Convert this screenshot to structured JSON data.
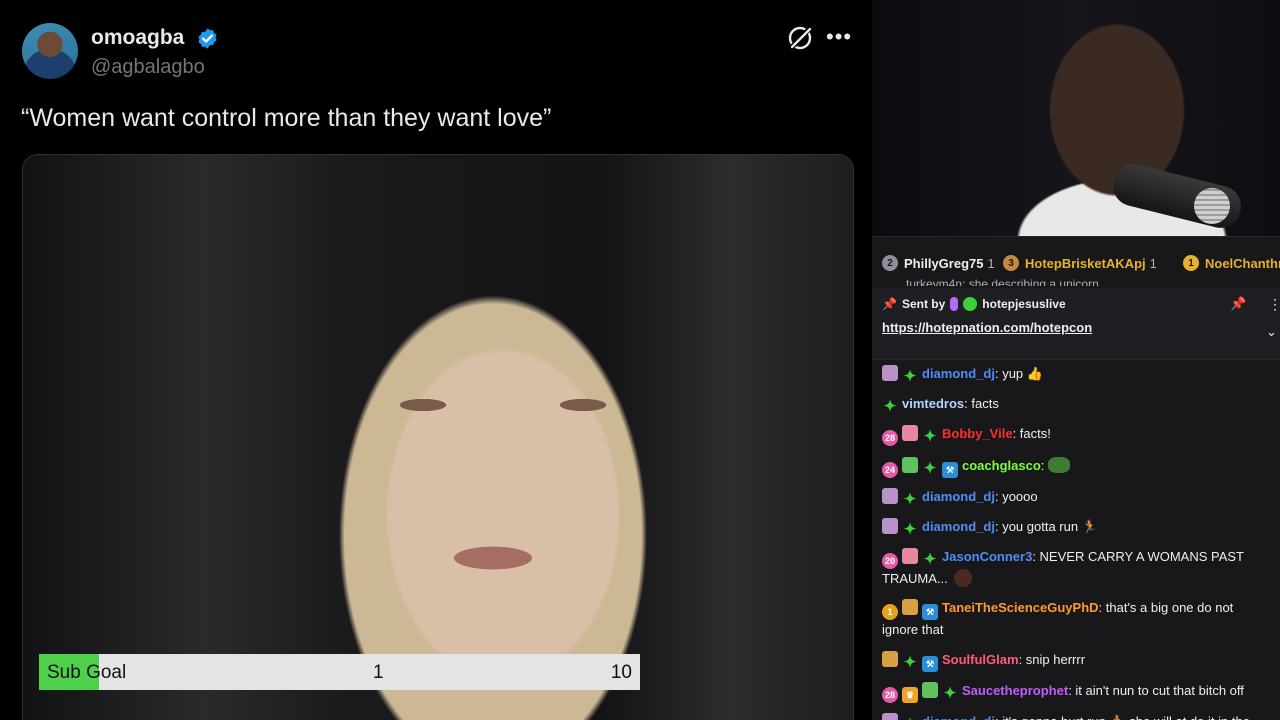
{
  "tweet": {
    "display_name": "omoagba",
    "handle": "@agbalagbo",
    "text": "“Women want control more than they want love”",
    "more_label": "•••"
  },
  "sub_goal": {
    "label": "Sub Goal",
    "current": "1",
    "target": "10",
    "progress_fraction": 0.1,
    "fill_color": "#4fd04a"
  },
  "leaderboard": {
    "entries": [
      {
        "rank": "2",
        "name": "PhillyGreg75",
        "count": "1",
        "badge_color": "#8f8f99"
      },
      {
        "rank": "3",
        "name": "HotepBrisketAKApj",
        "count": "1",
        "badge_color": "#c58a3e"
      },
      {
        "rank": "1",
        "name": "NoelChanthr",
        "count": "",
        "badge_color": "#e6b12d"
      }
    ],
    "peek_text": "turkeym4n: she describing a unicorn"
  },
  "pinned": {
    "sent_by_label": "Sent by",
    "user": "hotepjesuslive",
    "link": "https://hotepnation.com/hotepcon"
  },
  "messages": [
    {
      "badges": [
        "gift",
        "spark"
      ],
      "user": "diamond_dj",
      "color": "#4e8ef7",
      "text": "yup 👍"
    },
    {
      "badges": [
        "spark"
      ],
      "user": "vimtedros",
      "color": "#b3d4ff",
      "text": "facts"
    },
    {
      "badges": [
        "sub:28",
        "giftpink",
        "spark"
      ],
      "user": "Bobby_Vile",
      "color": "#ff2d2d",
      "text": "facts!"
    },
    {
      "badges": [
        "sub:24",
        "giftgreen",
        "spark",
        "hammer"
      ],
      "user": "coachglasco",
      "color": "#7cff3a",
      "text": "",
      "emote": true
    },
    {
      "badges": [
        "gift",
        "spark"
      ],
      "user": "diamond_dj",
      "color": "#4e8ef7",
      "text": "yoooo"
    },
    {
      "badges": [
        "gift",
        "spark"
      ],
      "user": "diamond_dj",
      "color": "#4e8ef7",
      "text": "you gotta run 🏃"
    },
    {
      "badges": [
        "sub:20",
        "giftpink",
        "spark"
      ],
      "user": "JasonConner3",
      "color": "#4e8ef7",
      "text": "NEVER CARRY A WOMANS PAST TRAUMA...",
      "emote_dark": true
    },
    {
      "badges": [
        "sub1:1",
        "giftgold",
        "hammer"
      ],
      "user": "TaneiTheScienceGuyPhD",
      "color": "#ff9a2e",
      "text": "that's a big one do not ignore that"
    },
    {
      "badges": [
        "giftgold",
        "spark",
        "hammer"
      ],
      "user": "SoulfulGlam",
      "color": "#ff5c7a",
      "text": "snip herrrr"
    },
    {
      "badges": [
        "sub:28",
        "crown",
        "giftgreen",
        "spark"
      ],
      "user": "Saucetheprophet",
      "color": "#c25cff",
      "text": "it ain't nun to cut that bitch off"
    },
    {
      "badges": [
        "gift",
        "spark"
      ],
      "user": "diamond_dj",
      "color": "#4e8ef7",
      "text": "it's gonna hurt run 🏃 she will at do it in the"
    }
  ]
}
